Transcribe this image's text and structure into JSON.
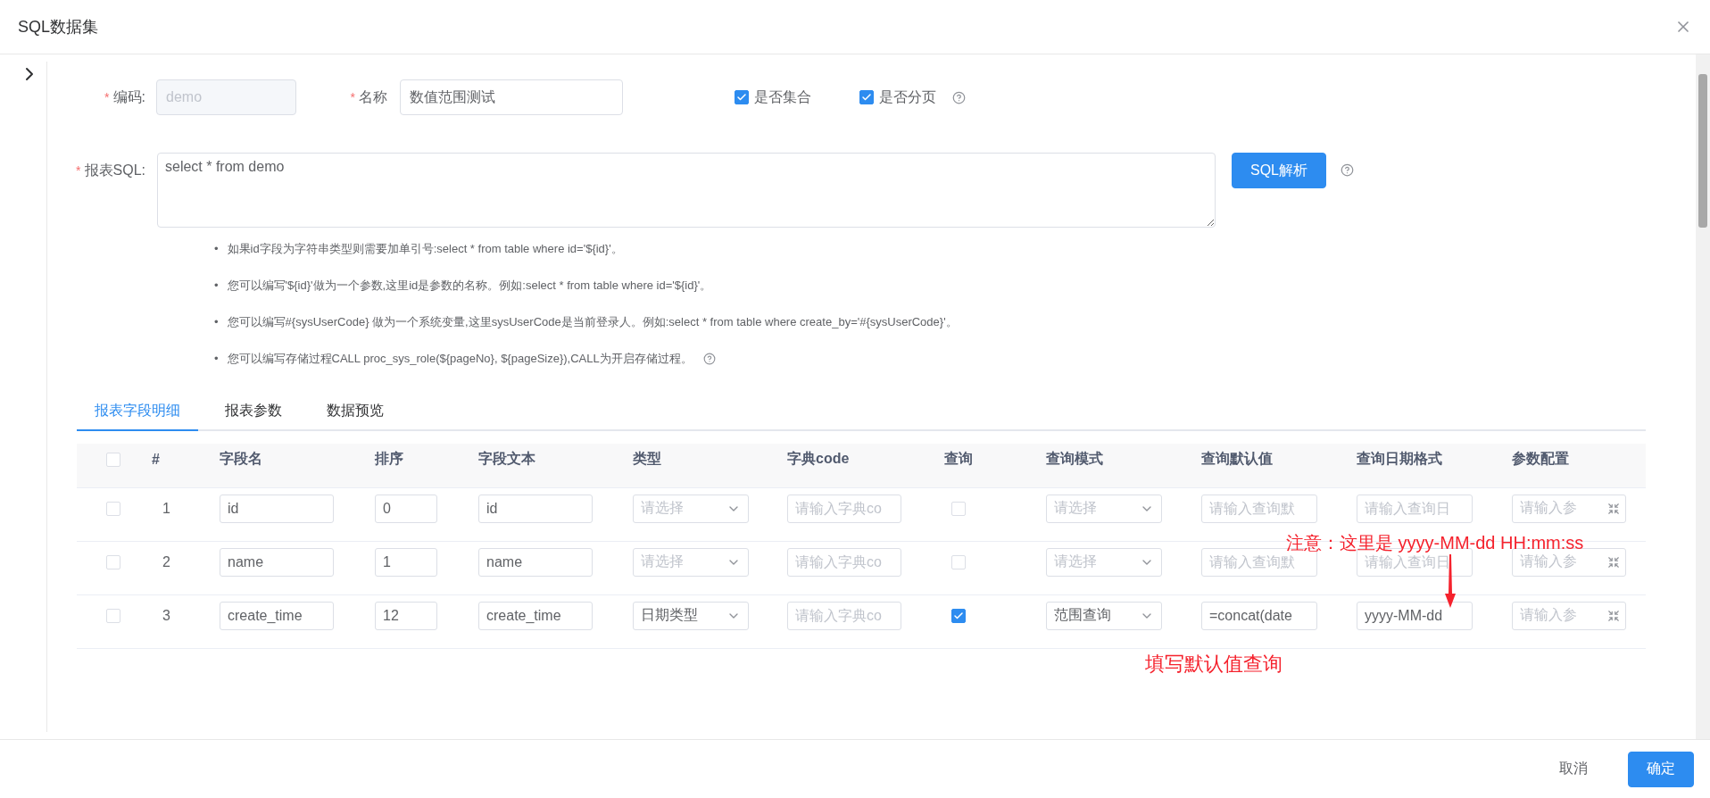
{
  "dialog": {
    "title": "SQL数据集"
  },
  "form": {
    "code": {
      "required_mark": "*",
      "label": "编码:",
      "value": "demo",
      "disabled": true
    },
    "name": {
      "required_mark": "*",
      "label": "名称",
      "value": "数值范围测试",
      "disabled": false
    },
    "options": [
      {
        "label": "是否集合",
        "checked": true,
        "help": false
      },
      {
        "label": "是否分页",
        "checked": true,
        "help": true
      }
    ]
  },
  "sql": {
    "required_mark": "*",
    "label": "报表SQL:",
    "value": "select * from demo",
    "button": "SQL解析",
    "hints": [
      {
        "bullet": "•",
        "text": "如果id字段为字符串类型则需要加单引号:select * from table where id='${id}'。",
        "help": false
      },
      {
        "bullet": "•",
        "text": "您可以编写'${id}'做为一个参数,这里id是参数的名称。例如:select * from table where id='${id}'。",
        "help": false
      },
      {
        "bullet": "•",
        "text": "您可以编写#{sysUserCode} 做为一个系统变量,这里sysUserCode是当前登录人。例如:select * from table where create_by='#{sysUserCode}'。",
        "help": false
      },
      {
        "bullet": "•",
        "text": "您可以编写存储过程CALL proc_sys_role(${pageNo}, ${pageSize}),CALL为开启存储过程。",
        "help": true
      }
    ]
  },
  "tabs": [
    {
      "label": "报表字段明细",
      "selected": true
    },
    {
      "label": "报表参数",
      "selected": false
    },
    {
      "label": "数据预览",
      "selected": false
    }
  ],
  "table": {
    "all_checked": false,
    "columns": [
      "#",
      "字段名",
      "排序",
      "字段文本",
      "类型",
      "字典code",
      "查询",
      "查询模式",
      "查询默认值",
      "查询日期格式",
      "参数配置"
    ],
    "rows": [
      {
        "checked": false,
        "index": "1",
        "field_name": {
          "value": "id"
        },
        "order": {
          "value": "0"
        },
        "field_text": {
          "value": "id"
        },
        "type": {
          "placeholder": "请选择"
        },
        "dict_code": {
          "placeholder": "请输入字典co"
        },
        "query": false,
        "query_mode": {
          "placeholder": "请选择"
        },
        "default_value": {
          "placeholder": "请输入查询默"
        },
        "date_format": {
          "placeholder": "请输入查询日"
        },
        "param_config": {
          "placeholder": "请输入参"
        }
      },
      {
        "checked": false,
        "index": "2",
        "field_name": {
          "value": "name"
        },
        "order": {
          "value": "1"
        },
        "field_text": {
          "value": "name"
        },
        "type": {
          "placeholder": "请选择"
        },
        "dict_code": {
          "placeholder": "请输入字典co"
        },
        "query": false,
        "query_mode": {
          "placeholder": "请选择"
        },
        "default_value": {
          "placeholder": "请输入查询默"
        },
        "date_format": {
          "placeholder": "请输入查询日"
        },
        "param_config": {
          "placeholder": "请输入参"
        }
      },
      {
        "checked": false,
        "index": "3",
        "field_name": {
          "value": "create_time"
        },
        "order": {
          "value": "12"
        },
        "field_text": {
          "value": "create_time"
        },
        "type": {
          "value": "日期类型"
        },
        "dict_code": {
          "placeholder": "请输入字典co"
        },
        "query": true,
        "query_mode": {
          "value": "范围查询"
        },
        "default_value": {
          "value": "=concat(date"
        },
        "date_format": {
          "value": "yyyy-MM-dd"
        },
        "param_config": {
          "placeholder": "请输入参"
        }
      }
    ]
  },
  "annotations": [
    {
      "text": "注意：这里是 yyyy-MM-dd HH:mm:ss",
      "arrow": true
    },
    {
      "text": "填写默认值查询",
      "arrow": false
    }
  ],
  "footer": {
    "buttons": [
      {
        "label": "取消",
        "kind": "default"
      },
      {
        "label": "确定",
        "kind": "primary"
      }
    ]
  }
}
